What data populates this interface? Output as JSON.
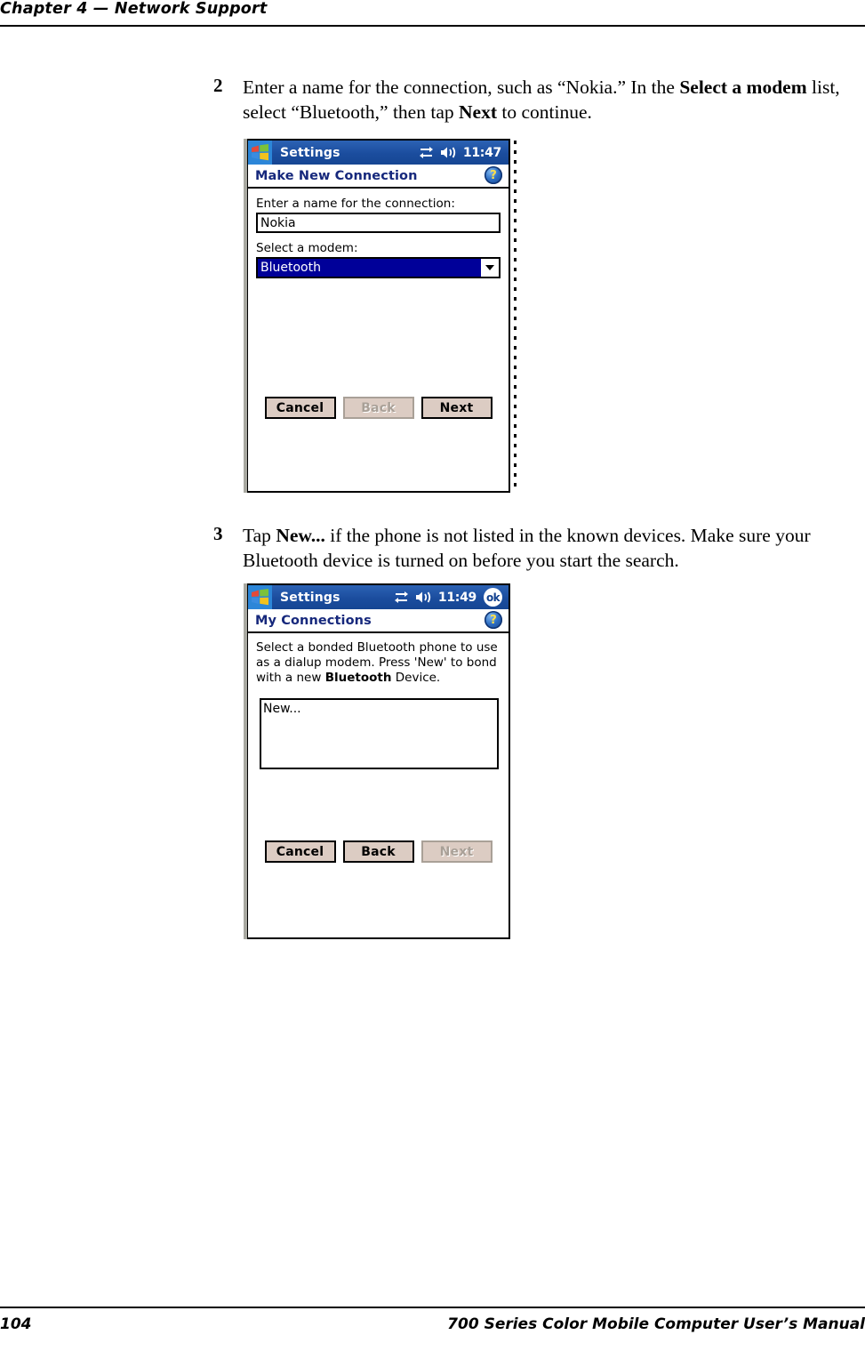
{
  "header": {
    "running_head": "Chapter 4  —  Network Support"
  },
  "footer": {
    "page_number": "104",
    "manual_title": "700 Series Color Mobile Computer User’s Manual"
  },
  "steps": [
    {
      "number": "2",
      "text_html": "Enter a name for the connection, such as “Nokia.” In the <b>Select a modem</b> list, select “Bluetooth,” then tap <b>Next</b> to continue."
    },
    {
      "number": "3",
      "text_html": "Tap <b>New...</b> if the phone is not listed in the known devices. Make sure your Bluetooth device is turned on before you start the search."
    }
  ],
  "screenshot1": {
    "titlebar": {
      "app_title": "Settings",
      "clock": "11:47",
      "connectivity_icon": "connectivity-icon",
      "volume_icon": "speaker-icon",
      "start_icon": "windows-flag-icon"
    },
    "caption": "Make New Connection",
    "help_icon_glyph": "?",
    "name_label": "Enter a name for the connection:",
    "name_value": "Nokia",
    "modem_label": "Select a modem:",
    "modem_value": "Bluetooth",
    "buttons": [
      {
        "label": "Cancel",
        "disabled": false
      },
      {
        "label": "Back",
        "disabled": true
      },
      {
        "label": "Next",
        "disabled": false
      }
    ],
    "taskbar": {
      "keyboard_icon": "keyboard-icon",
      "arrow_icon": "up-arrow-icon"
    }
  },
  "screenshot2": {
    "titlebar": {
      "app_title": "Settings",
      "clock": "11:49",
      "ok_label": "ok",
      "connectivity_icon": "connectivity-icon",
      "volume_icon": "speaker-icon",
      "start_icon": "windows-flag-icon"
    },
    "caption": "My Connections",
    "help_icon_glyph": "?",
    "instructions_html": "Select a bonded Bluetooth phone to use as a dialup modem. Press 'New' to bond with a new <b>Bluetooth</b> Device.",
    "list_items": [
      "New..."
    ],
    "buttons": [
      {
        "label": "Cancel",
        "disabled": false
      },
      {
        "label": "Back",
        "disabled": false
      },
      {
        "label": "Next",
        "disabled": true
      }
    ],
    "taskbar": {
      "keyboard_icon": "keyboard-icon",
      "arrow_icon": "up-arrow-icon"
    }
  },
  "colors": {
    "titlebar_blue": "#1b4d9e",
    "caption_blue": "#16287c",
    "selection_blue": "#000099",
    "button_face": "#dcccc3",
    "disabled_gray": "#a9a097"
  }
}
